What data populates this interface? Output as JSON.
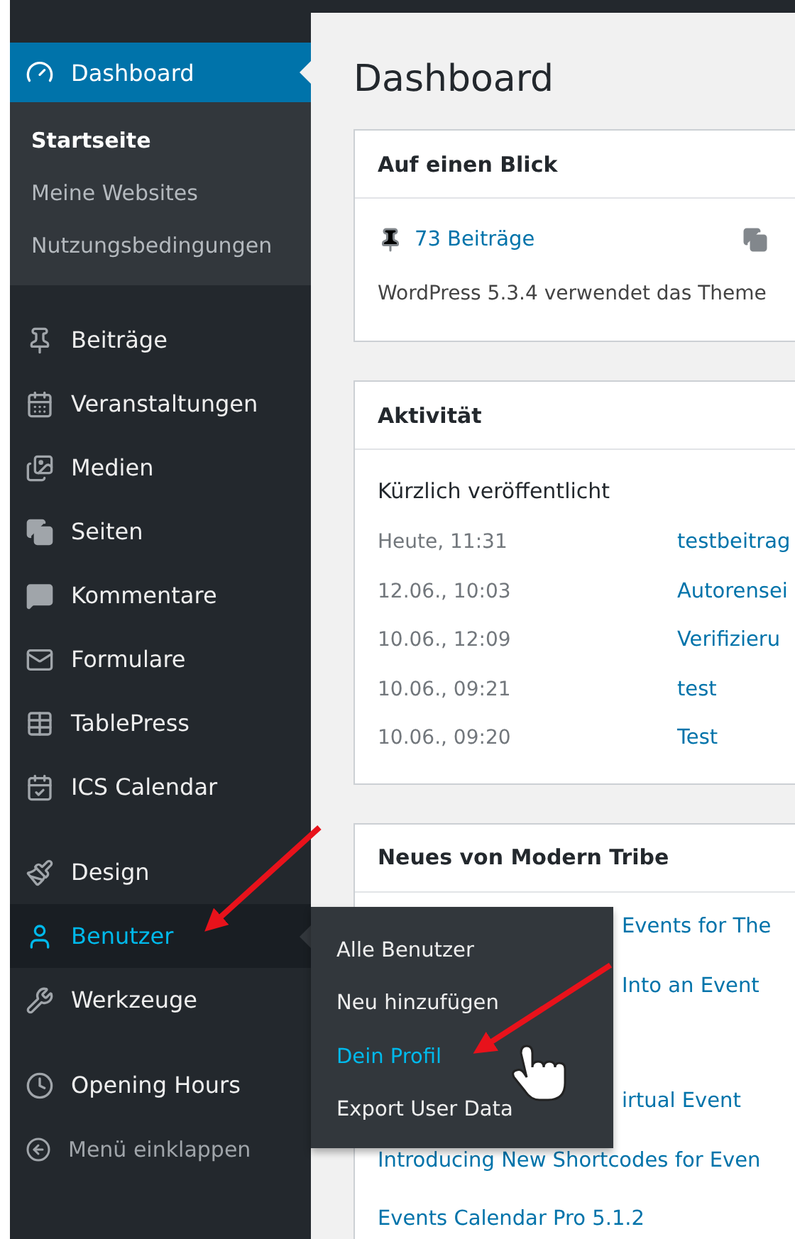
{
  "menu": {
    "items": [
      {
        "label": "Dashboard",
        "selected": true,
        "highlighted": false,
        "submenu": [
          {
            "label": "Startseite",
            "selected": true
          },
          {
            "label": "Meine Websites",
            "selected": false
          },
          {
            "label": "Nutzungsbedingungen",
            "selected": false
          }
        ]
      },
      {
        "label": "Beiträge",
        "selected": false,
        "highlighted": false
      },
      {
        "label": "Veranstaltungen",
        "selected": false,
        "highlighted": false
      },
      {
        "label": "Medien",
        "selected": false,
        "highlighted": false
      },
      {
        "label": "Seiten",
        "selected": false,
        "highlighted": false
      },
      {
        "label": "Kommentare",
        "selected": false,
        "highlighted": false
      },
      {
        "label": "Formulare",
        "selected": false,
        "highlighted": false
      },
      {
        "label": "TablePress",
        "selected": false,
        "highlighted": false
      },
      {
        "label": "ICS Calendar",
        "selected": false,
        "highlighted": false
      },
      {
        "label": "Design",
        "selected": false,
        "highlighted": false,
        "separator_before": true
      },
      {
        "label": "Benutzer",
        "selected": false,
        "highlighted": true,
        "flyout": [
          {
            "label": "Alle Benutzer",
            "highlighted": false
          },
          {
            "label": "Neu hinzufügen",
            "highlighted": false
          },
          {
            "label": "Dein Profil",
            "highlighted": true
          },
          {
            "label": "Export User Data",
            "highlighted": false
          }
        ]
      },
      {
        "label": "Werkzeuge",
        "selected": false,
        "highlighted": false
      },
      {
        "label": "Opening Hours",
        "selected": false,
        "highlighted": false,
        "separator_before": true
      },
      {
        "label": "Menü einklappen",
        "selected": false,
        "highlighted": false,
        "kind": "collapse"
      }
    ]
  },
  "page_title": "Dashboard",
  "at_a_glance": {
    "title": "Auf einen Blick",
    "posts": "73 Beiträge",
    "version_text": "WordPress 5.3.4 verwendet das Theme"
  },
  "activity": {
    "title": "Aktivität",
    "subtitle": "Kürzlich veröffentlicht",
    "rows": [
      {
        "date": "Heute, 11:31",
        "title": "testbeitrag"
      },
      {
        "date": "12.06., 10:03",
        "title": "Autorensei"
      },
      {
        "date": "10.06., 12:09",
        "title": "Verifizieru"
      },
      {
        "date": "10.06., 09:21",
        "title": "test"
      },
      {
        "date": "10.06., 09:20",
        "title": "Test"
      }
    ]
  },
  "news": {
    "title": "Neues von Modern Tribe",
    "items": [
      {
        "title": "Events for The",
        "kind": "partial"
      },
      {
        "title": "Into an Event",
        "kind": "partial"
      },
      {
        "title": "irtual Event",
        "kind": "partial"
      },
      {
        "title": "Introducing New Shortcodes for Even",
        "kind": "full"
      },
      {
        "title": "Events Calendar Pro 5.1.2",
        "kind": "full"
      }
    ]
  }
}
